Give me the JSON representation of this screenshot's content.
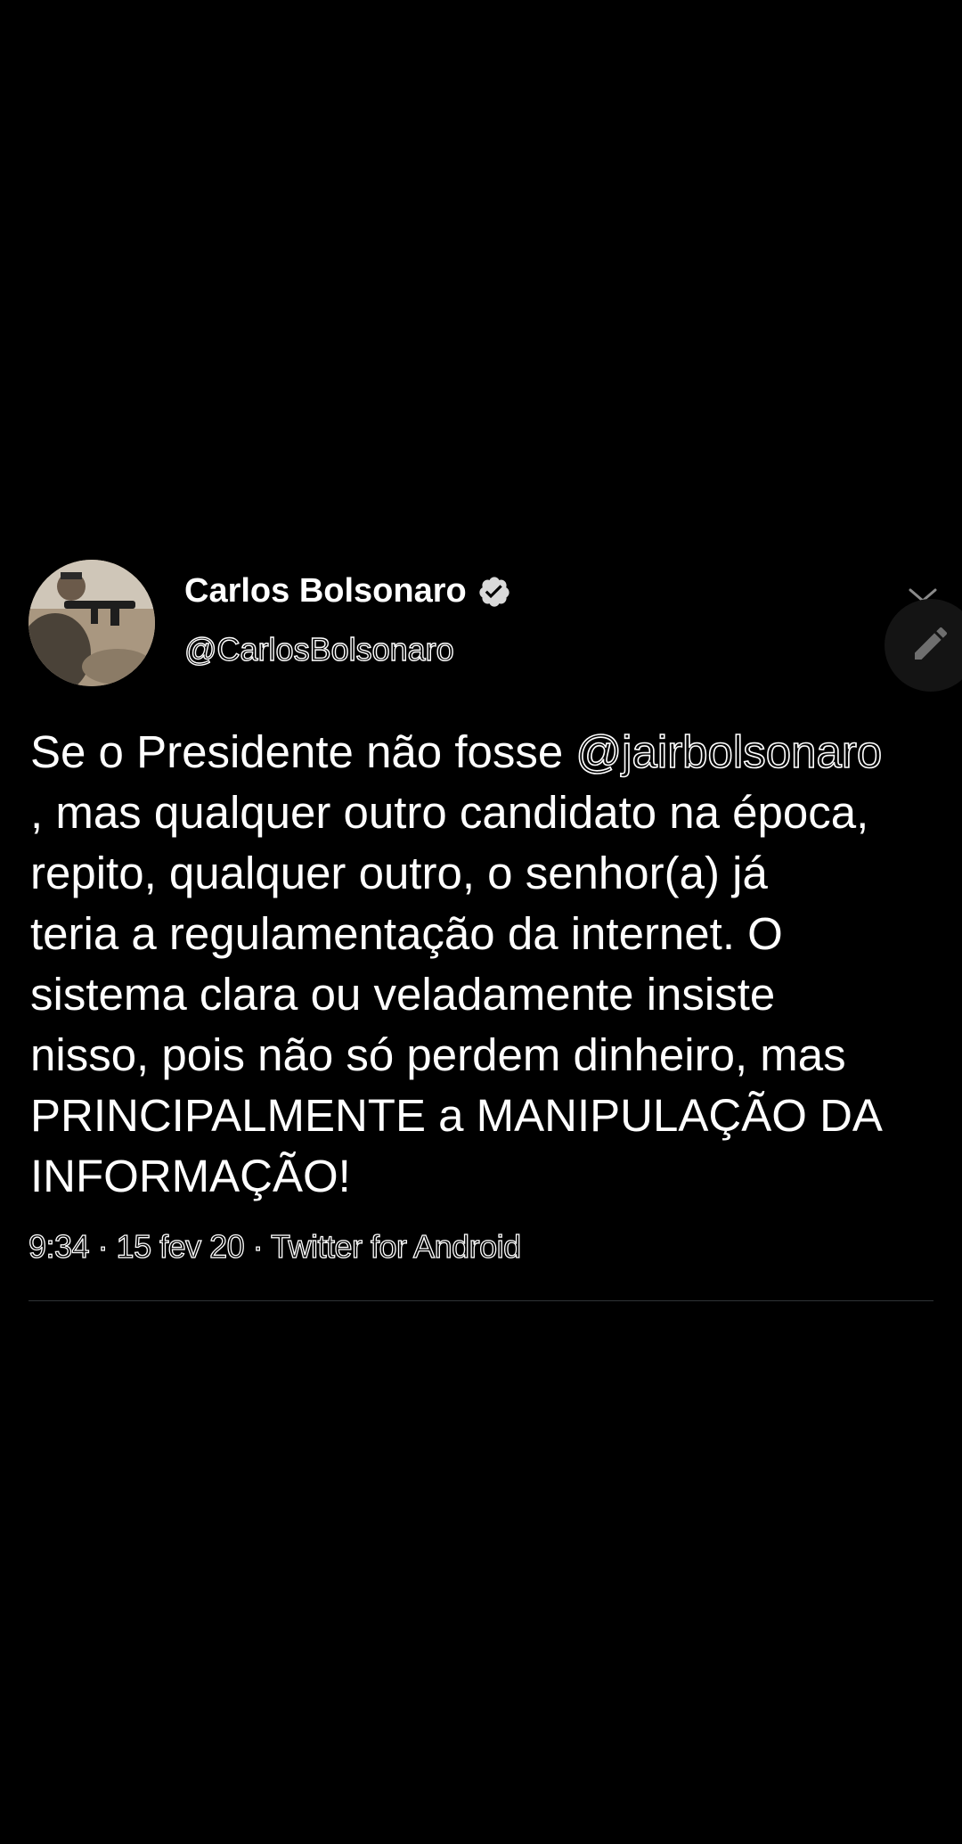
{
  "tweet": {
    "author": {
      "name": "Carlos Bolsonaro",
      "handle": "@CarlosBolsonaro",
      "verified_icon": "verified-badge-icon"
    },
    "text_lines": [
      {
        "before": "Se o Presidente não fosse ",
        "mention": "@jairbolsonaro"
      },
      {
        "text": ", mas qualquer outro candidato na época,"
      },
      {
        "text": "repito, qualquer outro, o senhor(a) já"
      },
      {
        "text": "teria a regulamentação da internet. O"
      },
      {
        "text": "sistema clara ou veladamente insiste"
      },
      {
        "text": "nisso, pois não só perdem dinheiro, mas"
      },
      {
        "text": "PRINCIPALMENTE a MANIPULAÇÃO DA"
      },
      {
        "text": "INFORMAÇÃO!"
      }
    ],
    "meta": "9:34 · 15 fev 20 · Twitter for Android"
  },
  "icons": {
    "more": "chevron-down-icon",
    "compose": "pencil-icon"
  },
  "colors": {
    "background": "#000000",
    "text": "#ffffff",
    "divider": "#2f3336",
    "fab": "#141414"
  }
}
